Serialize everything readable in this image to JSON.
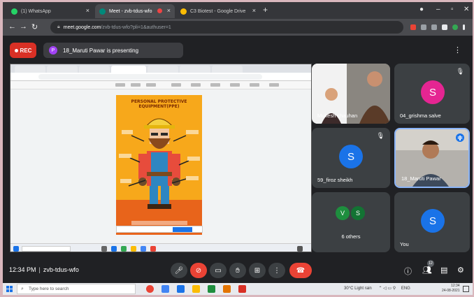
{
  "browser": {
    "tabs": [
      {
        "label": "(1) WhatsApp",
        "active": false,
        "favicon_color": "#25d366"
      },
      {
        "label": "Meet - zvb-tdus-wfo",
        "active": true,
        "favicon_color": "#00897b"
      },
      {
        "label": "C3 Biotest - Google Drive",
        "active": false,
        "favicon_color": "#fbbc04"
      }
    ],
    "url_host": "meet.google.com",
    "url_path": "/zvb-tdus-wfo?pli=1&authuser=1"
  },
  "meet": {
    "rec_label": "REC",
    "presenter_initial": "P",
    "presenting_text": "18_Maruti Pawar is presenting",
    "meeting_time": "12:34 PM",
    "meeting_code": "zvb-tdus-wfo",
    "people_count": "12"
  },
  "poster": {
    "title": "PERSONAL PROTECTIVE EQUIPMENT(PPE)"
  },
  "participants": [
    {
      "name": "Mukesh chauhan",
      "kind": "video"
    },
    {
      "name": "04_grishma salve",
      "kind": "avatar",
      "initial": "S",
      "color": "#e52592"
    },
    {
      "name": "59_firoz sheikh",
      "kind": "avatar",
      "initial": "S",
      "color": "#1a73e8"
    },
    {
      "name": "18_Maruti Pawar",
      "kind": "video"
    },
    {
      "name": "6 others",
      "kind": "group",
      "initials": [
        "V",
        "S"
      ]
    },
    {
      "name": "You",
      "kind": "avatar",
      "initial": "S",
      "color": "#1a73e8"
    }
  ],
  "taskbar": {
    "search_placeholder": "Type here to search",
    "weather": "30°C  Light rain",
    "lang": "ENG",
    "time": "12:34",
    "date": "24-08-2021"
  },
  "colors": {
    "rec": "#d93025",
    "end_call": "#ea4335",
    "active_speaker": "#8ab4f8"
  }
}
